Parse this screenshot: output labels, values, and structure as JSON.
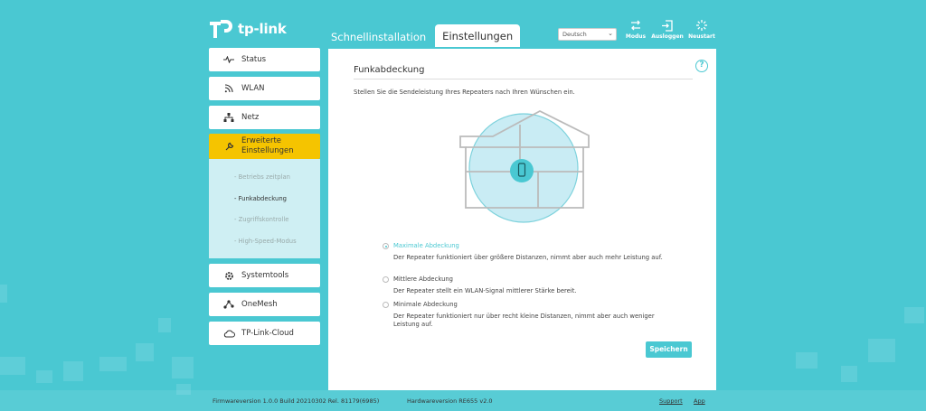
{
  "brand": {
    "name": "tp-link"
  },
  "tabs": [
    {
      "label": "Schnellinstallation"
    },
    {
      "label": "Einstellungen"
    }
  ],
  "language": {
    "selected": "Deutsch"
  },
  "header_buttons": [
    {
      "label": "Modus",
      "icon": "swap-arrows-icon"
    },
    {
      "label": "Ausloggen",
      "icon": "logout-icon"
    },
    {
      "label": "Neustart",
      "icon": "restart-icon"
    }
  ],
  "sidebar": {
    "items": [
      {
        "label": "Status",
        "icon": "pulse-icon"
      },
      {
        "label": "WLAN",
        "icon": "wifi-icon"
      },
      {
        "label": "Netz",
        "icon": "network-icon"
      },
      {
        "label_line1": "Erweiterte",
        "label_line2": "Einstellungen",
        "icon": "wrench-icon"
      },
      {
        "label": "Systemtools",
        "icon": "gear-icon"
      },
      {
        "label": "OneMesh",
        "icon": "mesh-icon"
      },
      {
        "label": "TP-Link-Cloud",
        "icon": "cloud-icon"
      }
    ],
    "subitems": [
      {
        "label": "- Betriebs zeitplan"
      },
      {
        "label": "- Funkabdeckung"
      },
      {
        "label": "- Zugriffskontrolle"
      },
      {
        "label": "- High-Speed-Modus"
      }
    ]
  },
  "content": {
    "title": "Funkabdeckung",
    "description": "Stellen Sie die Sendeleistung Ihres Repeaters nach Ihren Wünschen ein.",
    "options": [
      {
        "label": "Maximale Abdeckung",
        "desc": "Der Repeater funktioniert über größere Distanzen, nimmt aber auch mehr Leistung auf.",
        "selected": true
      },
      {
        "label": "Mittlere Abdeckung",
        "desc": "Der Repeater stellt ein WLAN-Signal mittlerer Stärke bereit.",
        "selected": false
      },
      {
        "label": "Minimale Abdeckung",
        "desc": "Der Repeater funktioniert nur über recht kleine Distanzen, nimmt aber auch weniger Leistung auf.",
        "selected": false
      }
    ],
    "save_label": "Speichern"
  },
  "footer": {
    "firmware": "Firmwareversion 1.0.0 Build 20210302 Rel. 81179(6985)",
    "hardware": "Hardwareversion RE655 v2.0",
    "support": "Support",
    "app": "App"
  },
  "colors": {
    "accent": "#4ac8d2",
    "active": "#f5c400"
  }
}
